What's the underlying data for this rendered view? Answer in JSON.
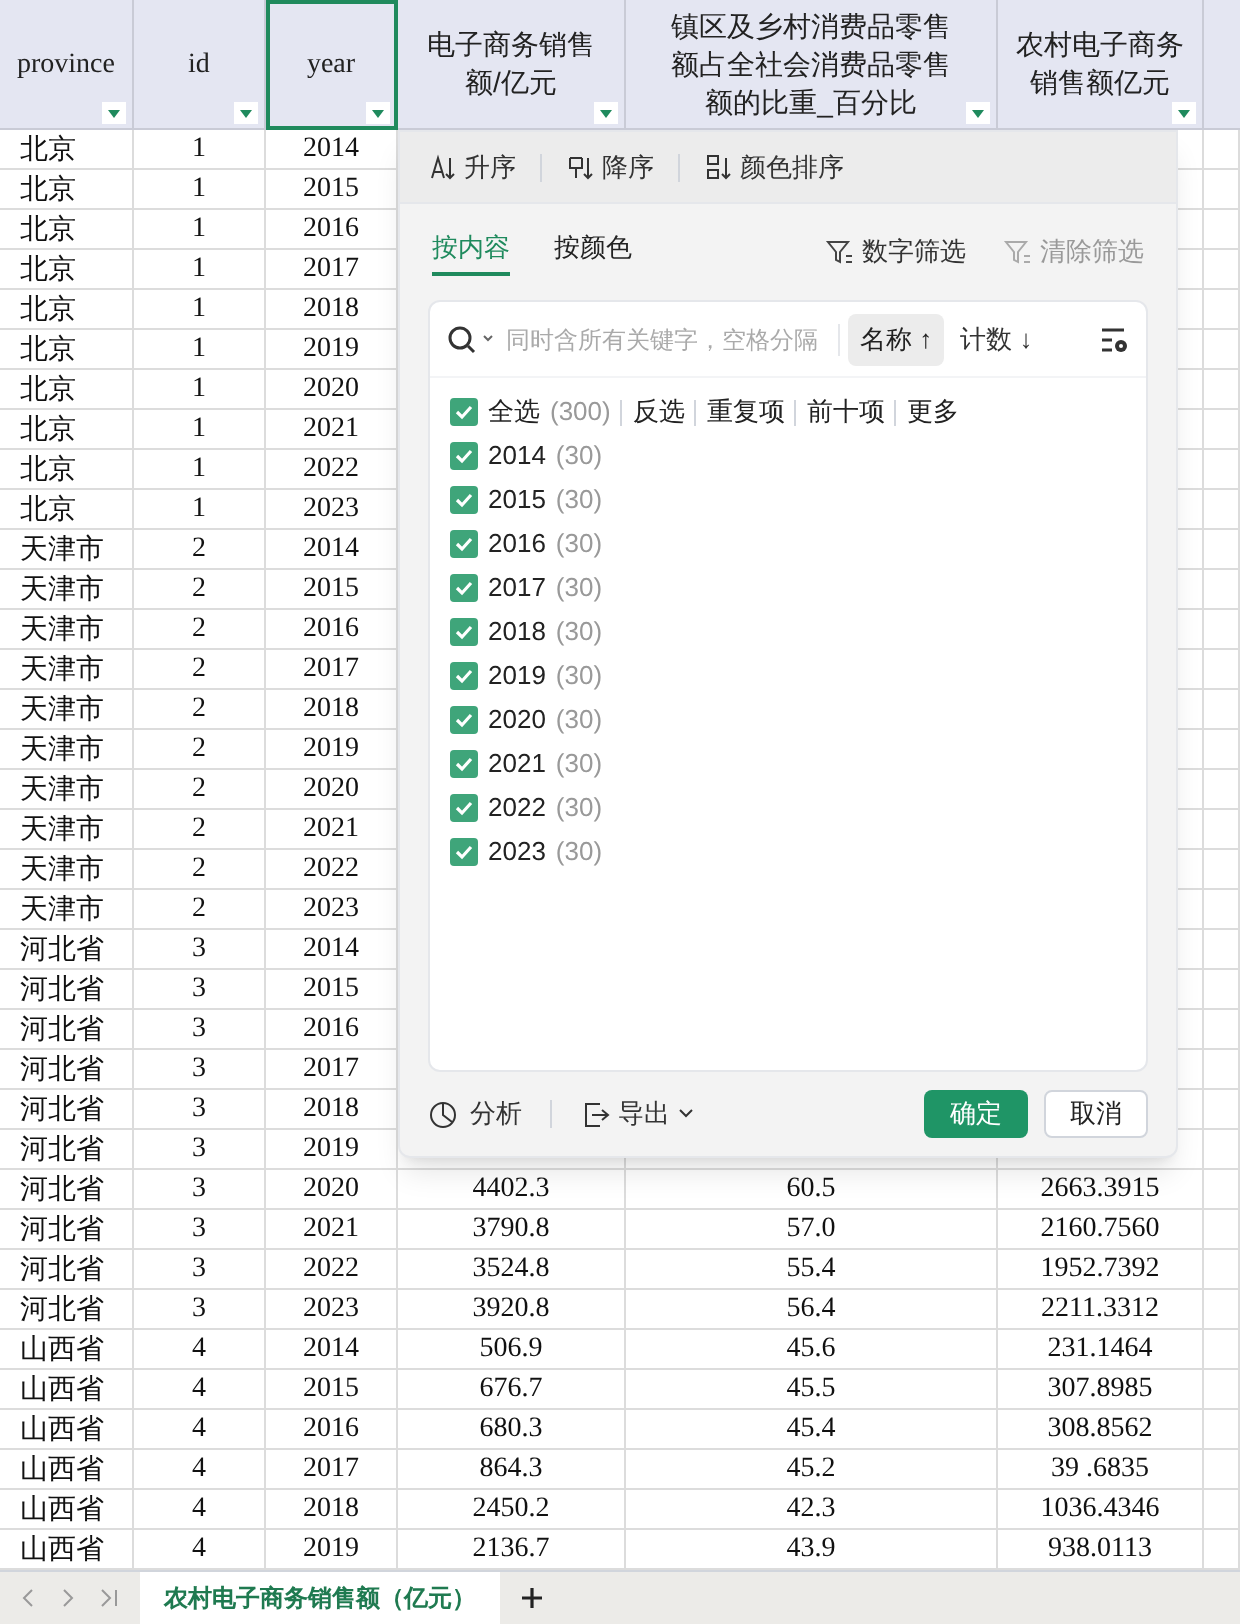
{
  "table": {
    "columns": [
      {
        "label": "province",
        "selected": false
      },
      {
        "label": "id",
        "selected": false
      },
      {
        "label": "year",
        "selected": true
      },
      {
        "label": "电子商务销售额/亿元",
        "selected": false
      },
      {
        "label": "镇区及乡村消费品零售额占全社会消费品零售额的比重_百分比",
        "selected": false
      },
      {
        "label": "农村电子商务销售额亿元",
        "selected": false
      }
    ],
    "rows": [
      {
        "cells": [
          "北京",
          "1",
          "2014"
        ]
      },
      {
        "cells": [
          "北京",
          "1",
          "2015"
        ]
      },
      {
        "cells": [
          "北京",
          "1",
          "2016"
        ]
      },
      {
        "cells": [
          "北京",
          "1",
          "2017"
        ]
      },
      {
        "cells": [
          "北京",
          "1",
          "2018"
        ]
      },
      {
        "cells": [
          "北京",
          "1",
          "2019"
        ]
      },
      {
        "cells": [
          "北京",
          "1",
          "2020"
        ]
      },
      {
        "cells": [
          "北京",
          "1",
          "2021"
        ]
      },
      {
        "cells": [
          "北京",
          "1",
          "2022"
        ]
      },
      {
        "cells": [
          "北京",
          "1",
          "2023"
        ]
      },
      {
        "cells": [
          "天津市",
          "2",
          "2014"
        ]
      },
      {
        "cells": [
          "天津市",
          "2",
          "2015"
        ]
      },
      {
        "cells": [
          "天津市",
          "2",
          "2016"
        ]
      },
      {
        "cells": [
          "天津市",
          "2",
          "2017"
        ]
      },
      {
        "cells": [
          "天津市",
          "2",
          "2018"
        ]
      },
      {
        "cells": [
          "天津市",
          "2",
          "2019"
        ]
      },
      {
        "cells": [
          "天津市",
          "2",
          "2020"
        ]
      },
      {
        "cells": [
          "天津市",
          "2",
          "2021"
        ]
      },
      {
        "cells": [
          "天津市",
          "2",
          "2022"
        ]
      },
      {
        "cells": [
          "天津市",
          "2",
          "2023"
        ]
      },
      {
        "cells": [
          "河北省",
          "3",
          "2014"
        ]
      },
      {
        "cells": [
          "河北省",
          "3",
          "2015"
        ]
      },
      {
        "cells": [
          "河北省",
          "3",
          "2016"
        ]
      },
      {
        "cells": [
          "河北省",
          "3",
          "2017"
        ]
      },
      {
        "cells": [
          "河北省",
          "3",
          "2018"
        ]
      },
      {
        "cells": [
          "河北省",
          "3",
          "2019"
        ]
      },
      {
        "cells": [
          "河北省",
          "3",
          "2020",
          "4402.3",
          "60.5",
          "2663.3915"
        ]
      },
      {
        "cells": [
          "河北省",
          "3",
          "2021",
          "3790.8",
          "57.0",
          "2160.7560"
        ]
      },
      {
        "cells": [
          "河北省",
          "3",
          "2022",
          "3524.8",
          "55.4",
          "1952.7392"
        ]
      },
      {
        "cells": [
          "河北省",
          "3",
          "2023",
          "3920.8",
          "56.4",
          "2211.3312"
        ]
      },
      {
        "cells": [
          "山西省",
          "4",
          "2014",
          "506.9",
          "45.6",
          "231.1464"
        ]
      },
      {
        "cells": [
          "山西省",
          "4",
          "2015",
          "676.7",
          "45.5",
          "307.8985"
        ]
      },
      {
        "cells": [
          "山西省",
          "4",
          "2016",
          "680.3",
          "45.4",
          "308.8562"
        ]
      },
      {
        "cells": [
          "山西省",
          "4",
          "2017",
          "864.3",
          "45.2",
          "39 .6835"
        ]
      },
      {
        "cells": [
          "山西省",
          "4",
          "2018",
          "2450.2",
          "42.3",
          "1036.4346"
        ]
      },
      {
        "cells": [
          "山西省",
          "4",
          "2019",
          "2136.7",
          "43.9",
          "938.0113"
        ]
      }
    ]
  },
  "filter_popup": {
    "sort_buttons": [
      {
        "label": "升序",
        "kind": "ascending"
      },
      {
        "label": "降序",
        "kind": "descending"
      },
      {
        "label": "颜色排序",
        "kind": "color"
      }
    ],
    "tabs": [
      {
        "label": "按内容",
        "selected": true
      },
      {
        "label": "按颜色",
        "selected": false
      }
    ],
    "number_filter": {
      "label": "数字筛选",
      "disabled": false
    },
    "clear_filter": {
      "label": "清除筛选",
      "disabled": true
    },
    "search": {
      "placeholder": "同时含所有关键字，空格分隔"
    },
    "sort_options": [
      {
        "label": "名称",
        "arrow": "↑",
        "selected": true
      },
      {
        "label": "计数",
        "arrow": "↓",
        "selected": false
      }
    ],
    "select_all": {
      "label": "全选",
      "count": "(300)",
      "checked": true
    },
    "quick_actions": [
      "反选",
      "重复项",
      "前十项",
      "更多"
    ],
    "items": [
      {
        "label": "2014",
        "count": "(30)",
        "checked": true
      },
      {
        "label": "2015",
        "count": "(30)",
        "checked": true
      },
      {
        "label": "2016",
        "count": "(30)",
        "checked": true
      },
      {
        "label": "2017",
        "count": "(30)",
        "checked": true
      },
      {
        "label": "2018",
        "count": "(30)",
        "checked": true
      },
      {
        "label": "2019",
        "count": "(30)",
        "checked": true
      },
      {
        "label": "2020",
        "count": "(30)",
        "checked": true
      },
      {
        "label": "2021",
        "count": "(30)",
        "checked": true
      },
      {
        "label": "2022",
        "count": "(30)",
        "checked": true
      },
      {
        "label": "2023",
        "count": "(30)",
        "checked": true
      }
    ],
    "footer": {
      "analyze": "分析",
      "export": "导出",
      "ok": "确定",
      "cancel": "取消"
    }
  },
  "sheet_tabs": [
    {
      "label": "农村电子商务销售额（亿元）",
      "selected": true
    }
  ]
}
